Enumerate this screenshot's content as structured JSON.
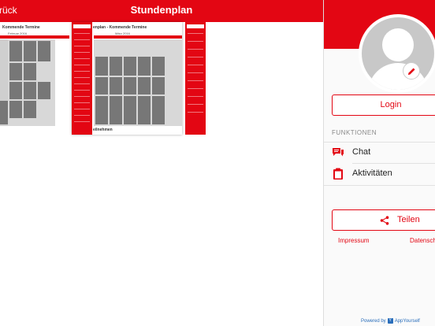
{
  "header": {
    "back_label": "rück",
    "title": "Stundenplan"
  },
  "thumbnails": {
    "left_heading": "Kommende Termine",
    "center_heading": "enplan - Kommende Termine",
    "center_footer": "eilnehmen",
    "left_month": "Februar 2016",
    "center_month": "März 2016"
  },
  "panel": {
    "login_label": "Login",
    "section_label": "FUNKTIONEN",
    "menu": [
      {
        "label": "Chat",
        "icon": "chat-icon"
      },
      {
        "label": "Aktivitäten",
        "icon": "clipboard-icon"
      }
    ],
    "share_label": "Teilen",
    "links": {
      "impressum": "Impressum",
      "datenschutz": "Datensch"
    },
    "powered_by": "Powered by",
    "powered_brand": "AppYourself"
  },
  "colors": {
    "accent": "#e30613",
    "link_blue": "#2a6ebb"
  }
}
